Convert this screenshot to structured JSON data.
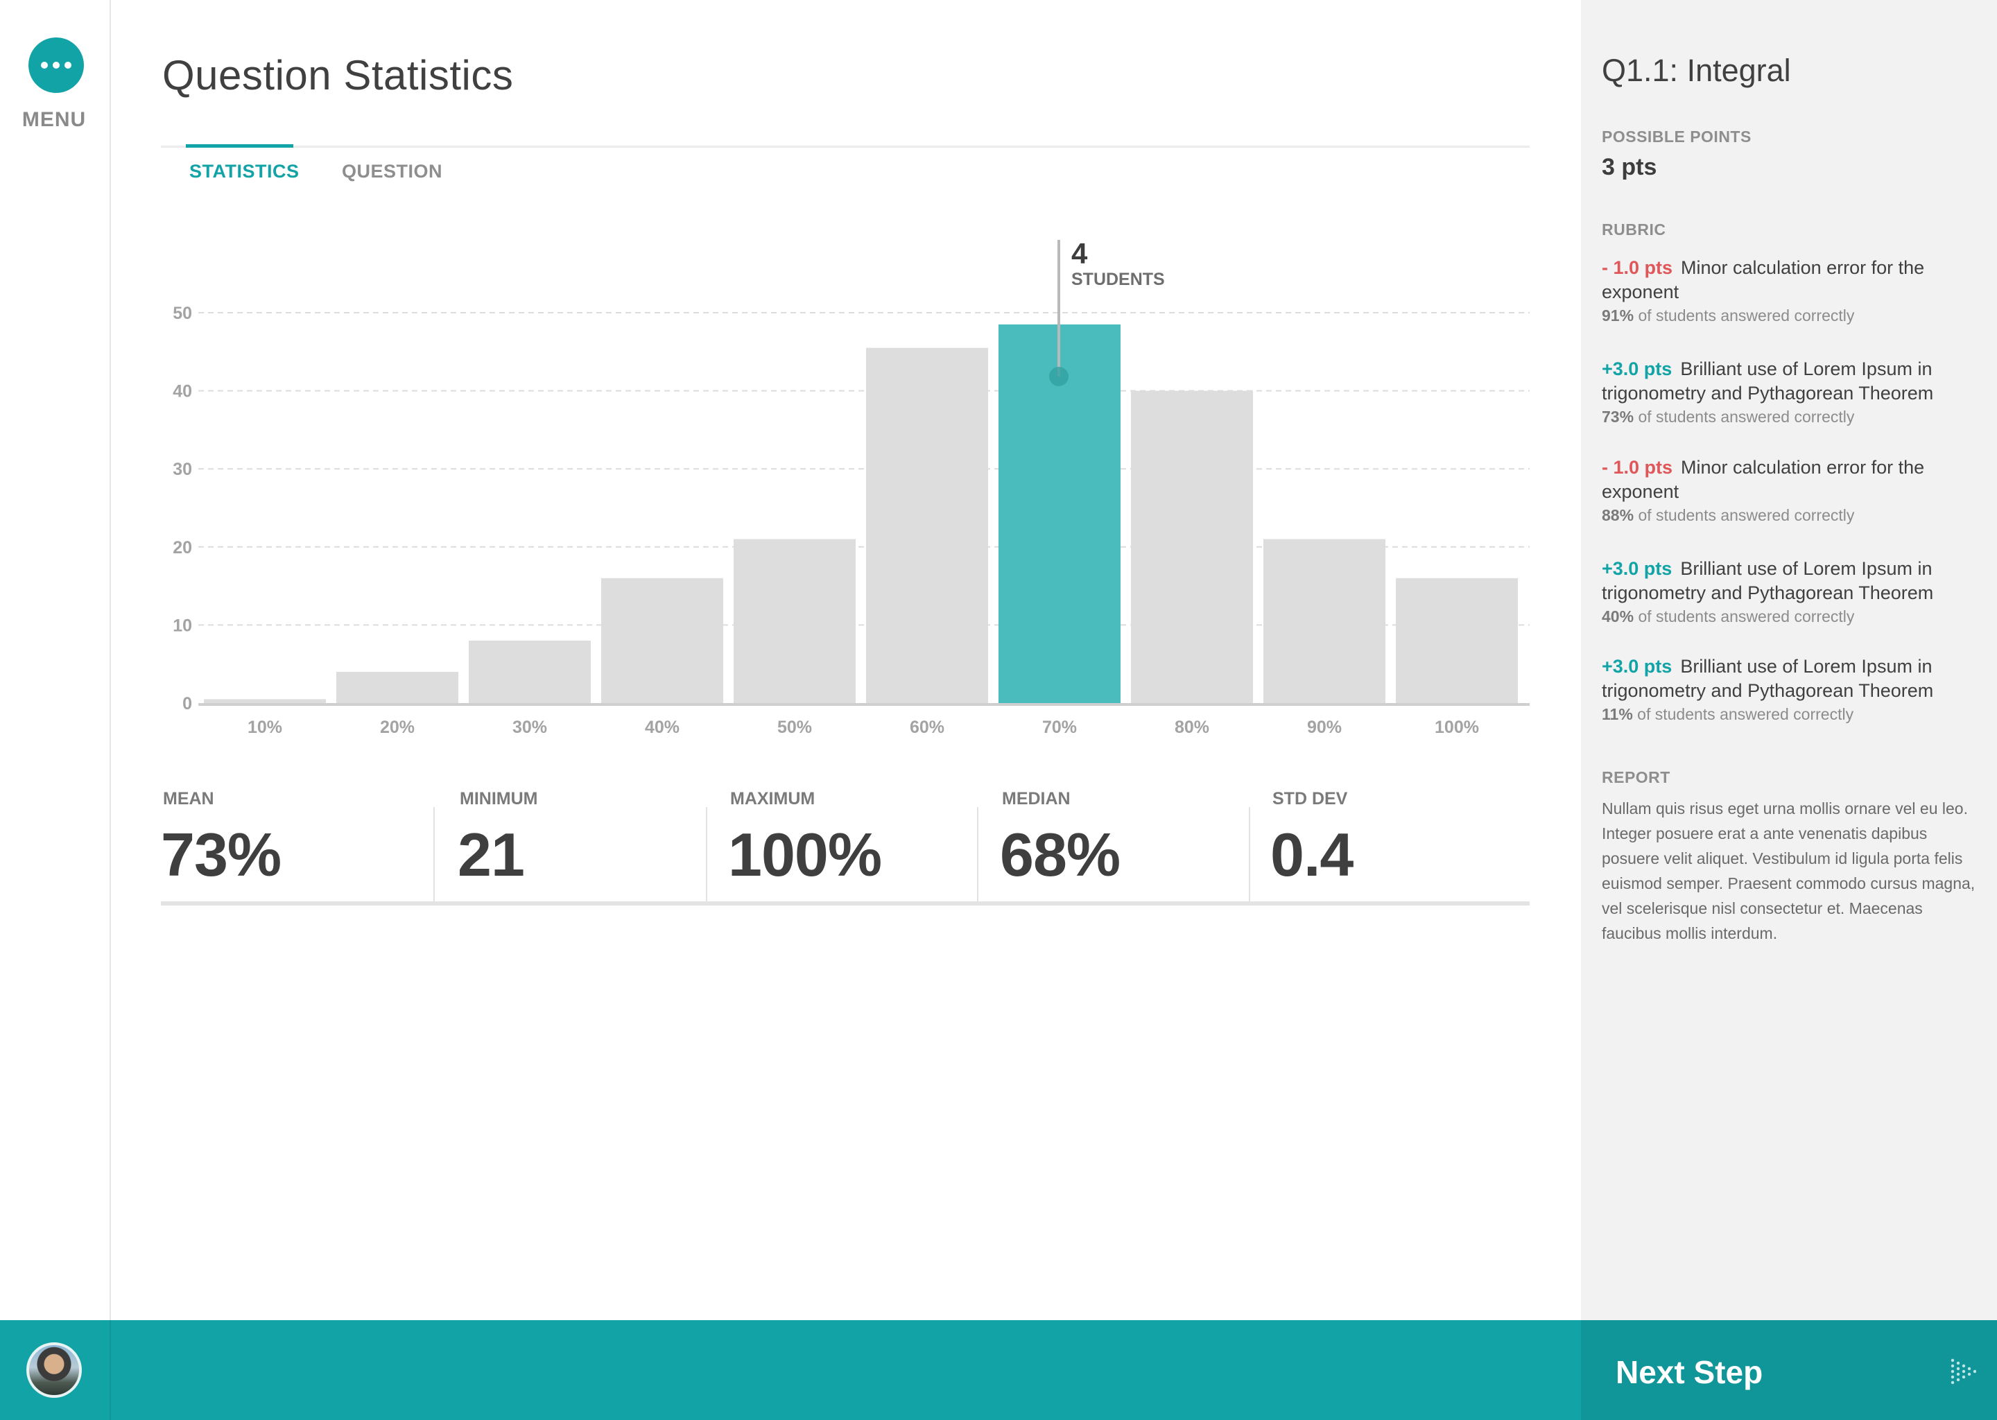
{
  "menu": {
    "label": "MENU"
  },
  "page": {
    "title": "Question Statistics"
  },
  "tabs": [
    {
      "label": "STATISTICS",
      "active": true
    },
    {
      "label": "QUESTION",
      "active": false
    }
  ],
  "chart_data": {
    "type": "bar",
    "categories": [
      "10%",
      "20%",
      "30%",
      "40%",
      "50%",
      "60%",
      "70%",
      "80%",
      "90%",
      "100%"
    ],
    "values": [
      0.5,
      4,
      8,
      16,
      21,
      45.5,
      48.5,
      40,
      21,
      16
    ],
    "ylim": [
      0,
      50
    ],
    "yticks": [
      0,
      10,
      20,
      30,
      40,
      50
    ],
    "grid": true,
    "highlight_index": 6,
    "highlight_color": "#4bbcbd",
    "bar_color": "#dddddd",
    "tooltip": {
      "value": "4",
      "label": "STUDENTS"
    }
  },
  "stats": [
    {
      "label": "MEAN",
      "value": "73%"
    },
    {
      "label": "MINIMUM",
      "value": "21"
    },
    {
      "label": "MAXIMUM",
      "value": "100%"
    },
    {
      "label": "MEDIAN",
      "value": "68%"
    },
    {
      "label": "STD DEV",
      "value": "0.4"
    }
  ],
  "panel": {
    "question_title": "Q1.1: Integral",
    "possible_points_label": "POSSIBLE POINTS",
    "possible_points": "3 pts",
    "rubric_label": "RUBRIC",
    "rubric": [
      {
        "points": "- 1.0 pts",
        "kind": "neg",
        "text": "Minor calculation error for the exponent",
        "percent": "91%",
        "note": "of students answered correctly"
      },
      {
        "points": "+3.0 pts",
        "kind": "pos",
        "text": "Brilliant use of Lorem Ipsum in trigonometry and Pythagorean Theorem",
        "percent": "73%",
        "note": "of students answered correctly"
      },
      {
        "points": "- 1.0 pts",
        "kind": "neg",
        "text": "Minor calculation error for the exponent",
        "percent": "88%",
        "note": "of students answered correctly"
      },
      {
        "points": "+3.0 pts",
        "kind": "pos",
        "text": "Brilliant use of Lorem Ipsum in trigonometry and Pythagorean Theorem",
        "percent": "40%",
        "note": "of students answered correctly"
      },
      {
        "points": "+3.0 pts",
        "kind": "pos",
        "text": "Brilliant use of Lorem Ipsum in trigonometry and Pythagorean Theorem",
        "percent": "11%",
        "note": "of students answered correctly"
      }
    ],
    "report_label": "REPORT",
    "report_text": "Nullam quis risus eget urna mollis ornare vel eu leo. Integer posuere erat a ante venenatis dapibus posuere velit aliquet. Vestibulum id ligula porta felis euismod semper. Praesent commodo cursus magna, vel scelerisque nisl consectetur et. Maecenas faucibus mollis interdum."
  },
  "footer": {
    "next_label": "Next Step"
  },
  "colors": {
    "accent": "#11a3a5",
    "negative": "#e0575a",
    "panel_bg": "#f2f2f2"
  }
}
